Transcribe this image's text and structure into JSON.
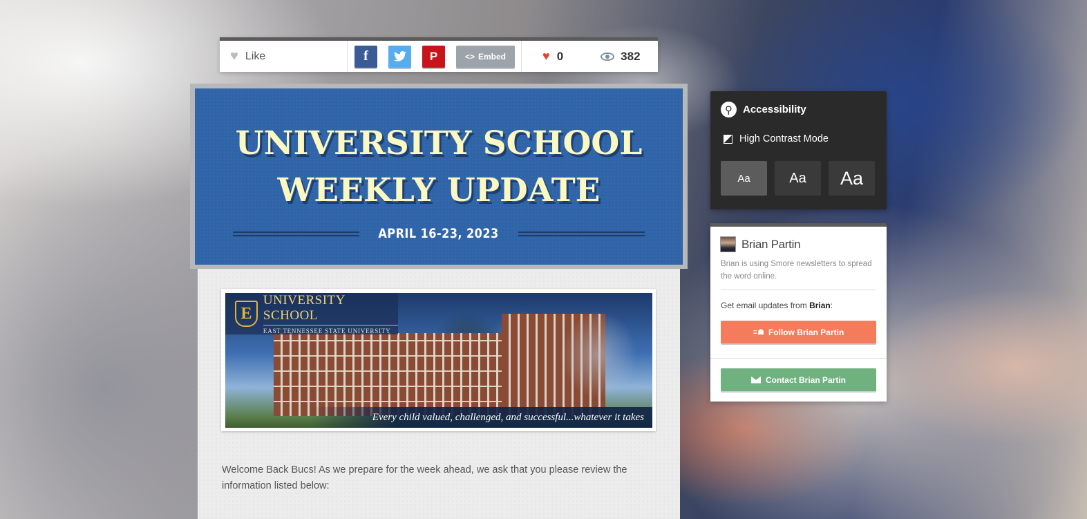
{
  "toolbar": {
    "like_label": "Like",
    "share_buttons": [
      "f",
      "t",
      "P"
    ],
    "embed_label": "Embed",
    "likes_count": "0",
    "views_count": "382"
  },
  "newsletter": {
    "title_line1": "UNIVERSITY SCHOOL",
    "title_line2": "WEEKLY UPDATE",
    "date": "APRIL 16-23, 2023",
    "banner": {
      "logo_letter": "E",
      "logo_main": "UNIVERSITY SCHOOL",
      "logo_sub": "EAST TENNESSEE STATE UNIVERSITY",
      "tagline": "Every child valued, challenged, and successful...whatever it takes"
    },
    "intro": "Welcome Back Bucs! As we prepare for the week ahead, we ask that you please review the information listed below:"
  },
  "accessibility": {
    "title": "Accessibility",
    "high_contrast_label": "High Contrast Mode",
    "font_sizes": [
      "Aa",
      "Aa",
      "Aa"
    ],
    "active_size_index": 0
  },
  "author": {
    "name": "Brian Partin",
    "description": "Brian is using Smore newsletters to spread the word online.",
    "updates_prefix": "Get email updates from ",
    "updates_name": "Brian",
    "updates_suffix": ":",
    "follow_label": "Follow Brian Partin",
    "contact_label": "Contact Brian Partin"
  },
  "colors": {
    "header_blue": "#2f64a8",
    "title_cream": "#fbf8c2",
    "follow_orange": "#f47c5a",
    "contact_green": "#6fb27f",
    "panel_dark": "#2a2a2a"
  }
}
